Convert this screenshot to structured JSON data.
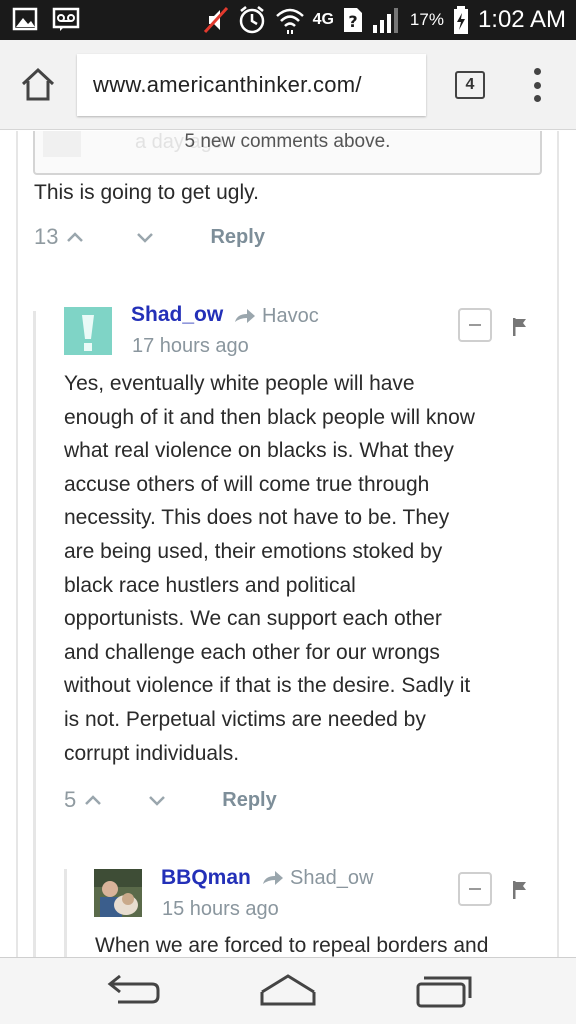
{
  "status_bar": {
    "network": "4G",
    "battery_percent": "17%",
    "time": "1:02 AM",
    "icons": [
      "gallery-icon",
      "voicemail-icon",
      "mute-icon",
      "alarm-icon",
      "wifi-icon",
      "data-icon",
      "sim-unknown-icon",
      "signal-icon",
      "battery-charging-icon"
    ]
  },
  "browser": {
    "url": "www.americanthinker.com/",
    "tab_count": "4"
  },
  "banner": {
    "ghost_text": "a day ago",
    "text": "5 new comments above."
  },
  "comments": [
    {
      "text": "This is going to get ugly.",
      "votes": "13",
      "reply_label": "Reply"
    },
    {
      "author": "Shad_ow",
      "reply_to": "Havoc",
      "timestamp": "17 hours ago",
      "lines": [
        "Yes, eventually white people will have",
        "enough of it and then black people will know",
        "what real violence on blacks is. What they",
        "accuse others of will come true through",
        "necessity. This does not have to be. They",
        "are being used, their emotions stoked by",
        "black race hustlers and political",
        "opportunists. We can support each other",
        "and challenge each other for our wrongs",
        "without violence if that is the desire. Sadly it",
        "is not. Perpetual victims are needed by",
        "corrupt individuals."
      ],
      "votes": "5",
      "reply_label": "Reply"
    },
    {
      "author": "BBQman",
      "reply_to": "Shad_ow",
      "timestamp": "15 hours ago",
      "text": "When we are forced to repeal borders and"
    }
  ],
  "colors": {
    "author": "#2330b8",
    "meta": "#8a969e",
    "status_bar": "#1a1a1a"
  },
  "nav_bar": {
    "icons": [
      "back-icon",
      "home-icon",
      "recent-apps-icon"
    ]
  }
}
